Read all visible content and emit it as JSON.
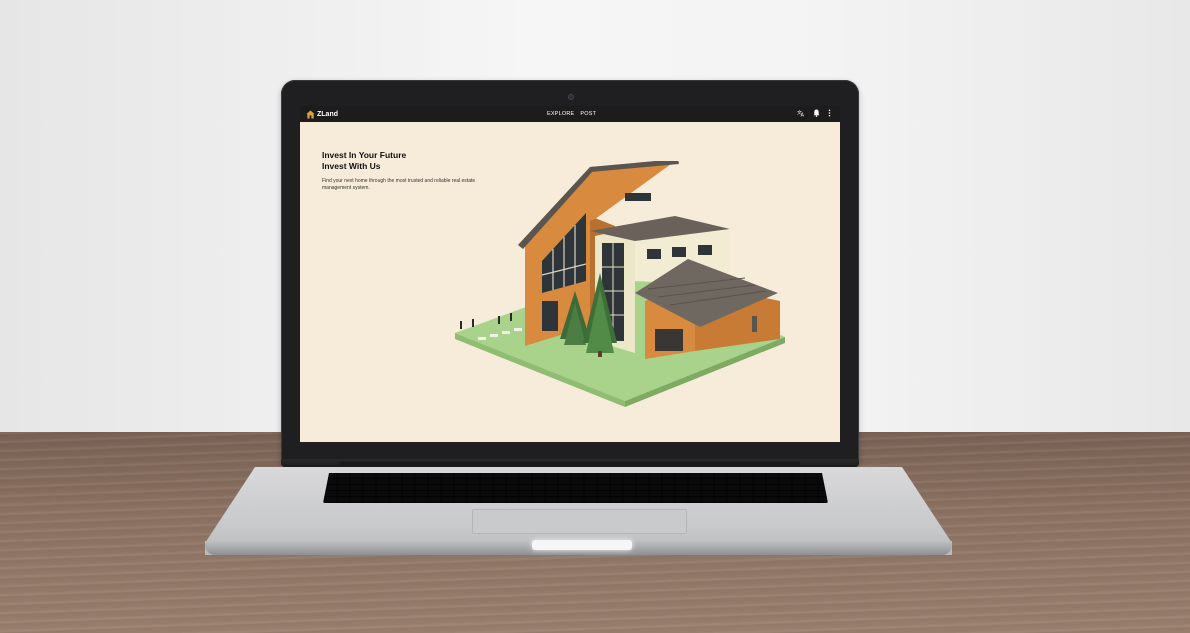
{
  "app": {
    "name": "ZLand"
  },
  "nav": {
    "items": [
      "EXPLORE",
      "POST"
    ]
  },
  "header_icons": [
    "translate-icon",
    "bell-icon",
    "more-vertical-icon"
  ],
  "hero": {
    "title_line1": "Invest In Your Future",
    "title_line2": "Invest With Us",
    "subtitle": "Find your next home through the most trusted and reliable real estate management system."
  },
  "colors": {
    "screen_bg": "#f7ecd9",
    "appbar_bg": "#1c1c1c",
    "house_orange": "#d88a3e",
    "grass": "#a9d38a"
  }
}
